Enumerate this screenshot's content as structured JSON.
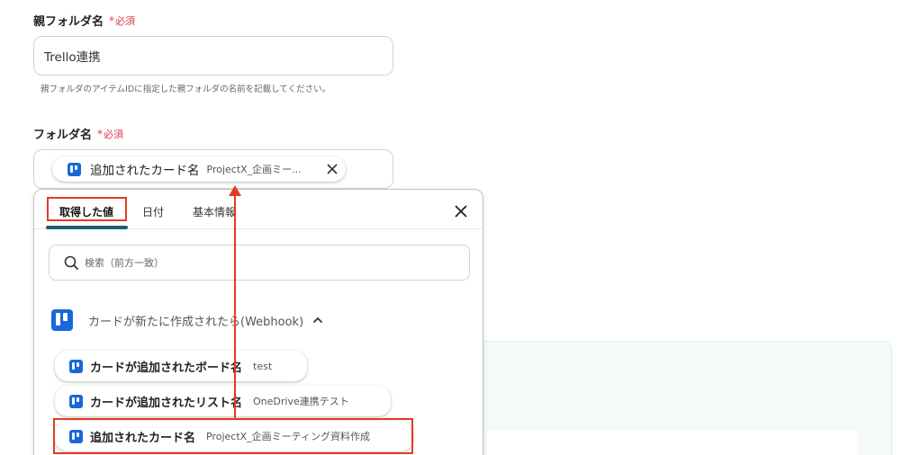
{
  "parent_folder": {
    "label": "親フォルダ名",
    "required": "必須",
    "required_mark": "*",
    "value": "Trello連携",
    "help": "親フォルダのアイテムIDに指定した親フォルダの名前を記載してください。"
  },
  "folder": {
    "label": "フォルダ名",
    "required": "必須",
    "required_mark": "*",
    "chip": {
      "label": "追加されたカード名",
      "value": "ProjectX_企画ミー...",
      "icon": "trello-icon",
      "remove_icon": "close-icon"
    }
  },
  "picker": {
    "tabs": [
      "取得した値",
      "日付",
      "基本情報"
    ],
    "active_tab": 0,
    "close_icon": "close-icon",
    "search": {
      "placeholder": "検索（前方一致）",
      "icon": "search-icon"
    },
    "trigger": {
      "title": "カードが新たに作成されたら(Webhook)",
      "icon": "trello-icon",
      "toggle_icon": "chevron-up-icon"
    },
    "items": [
      {
        "label": "カードが追加されたボード名",
        "value": "test"
      },
      {
        "label": "カードが追加されたリスト名",
        "value": "OneDrive連携テスト"
      },
      {
        "label": "追加されたカード名",
        "value": "ProjectX_企画ミーティング資料作成"
      }
    ]
  },
  "colors": {
    "trello_blue": "#1868db",
    "required_red": "#e0384b",
    "highlight_red": "#e53a24",
    "tab_underline": "#17606f"
  }
}
